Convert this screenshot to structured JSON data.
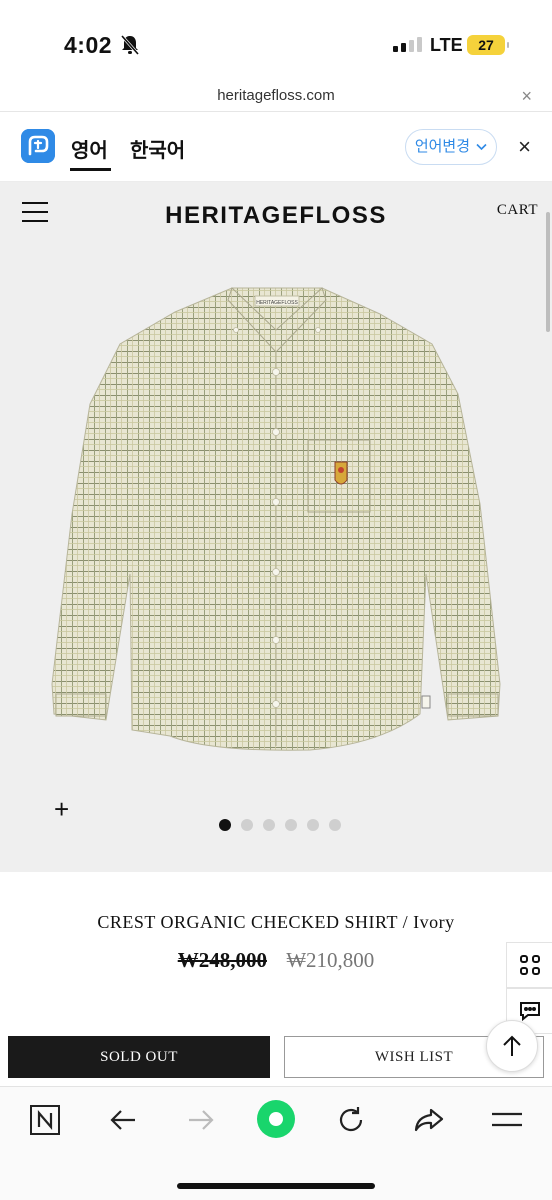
{
  "status_bar": {
    "time": "4:02",
    "network": "LTE",
    "battery": "27"
  },
  "browser": {
    "url": "heritagefloss.com",
    "close_label": "×"
  },
  "translate_bar": {
    "tab_english": "영어",
    "tab_korean": "한국어",
    "change_language": "언어변경",
    "close_label": "×"
  },
  "site": {
    "brand": "HERITAGEFLOSS",
    "cart_label": "CART",
    "carousel_total": 6,
    "carousel_active": 1
  },
  "product": {
    "name": "CREST ORGANIC CHECKED SHIRT / Ivory",
    "original_price": "₩248,000",
    "sale_price": "₩210,800",
    "sold_out_label": "SOLD OUT",
    "wishlist_label": "WISH LIST",
    "shirt_tag": "HERITAGEFLOSS"
  },
  "icons": [
    "bell-slash-icon",
    "hamburger-icon",
    "plus-icon",
    "grid-icon",
    "chat-icon",
    "arrow-up-icon",
    "naver-n-icon",
    "back-arrow-icon",
    "forward-arrow-icon",
    "green-circle-icon",
    "reload-icon",
    "share-icon",
    "menu-icon"
  ],
  "colors": {
    "accent_blue": "#2f8ae6",
    "battery": "#f5d23b",
    "green": "#19d56c",
    "dark_button": "#1a1a1a"
  }
}
